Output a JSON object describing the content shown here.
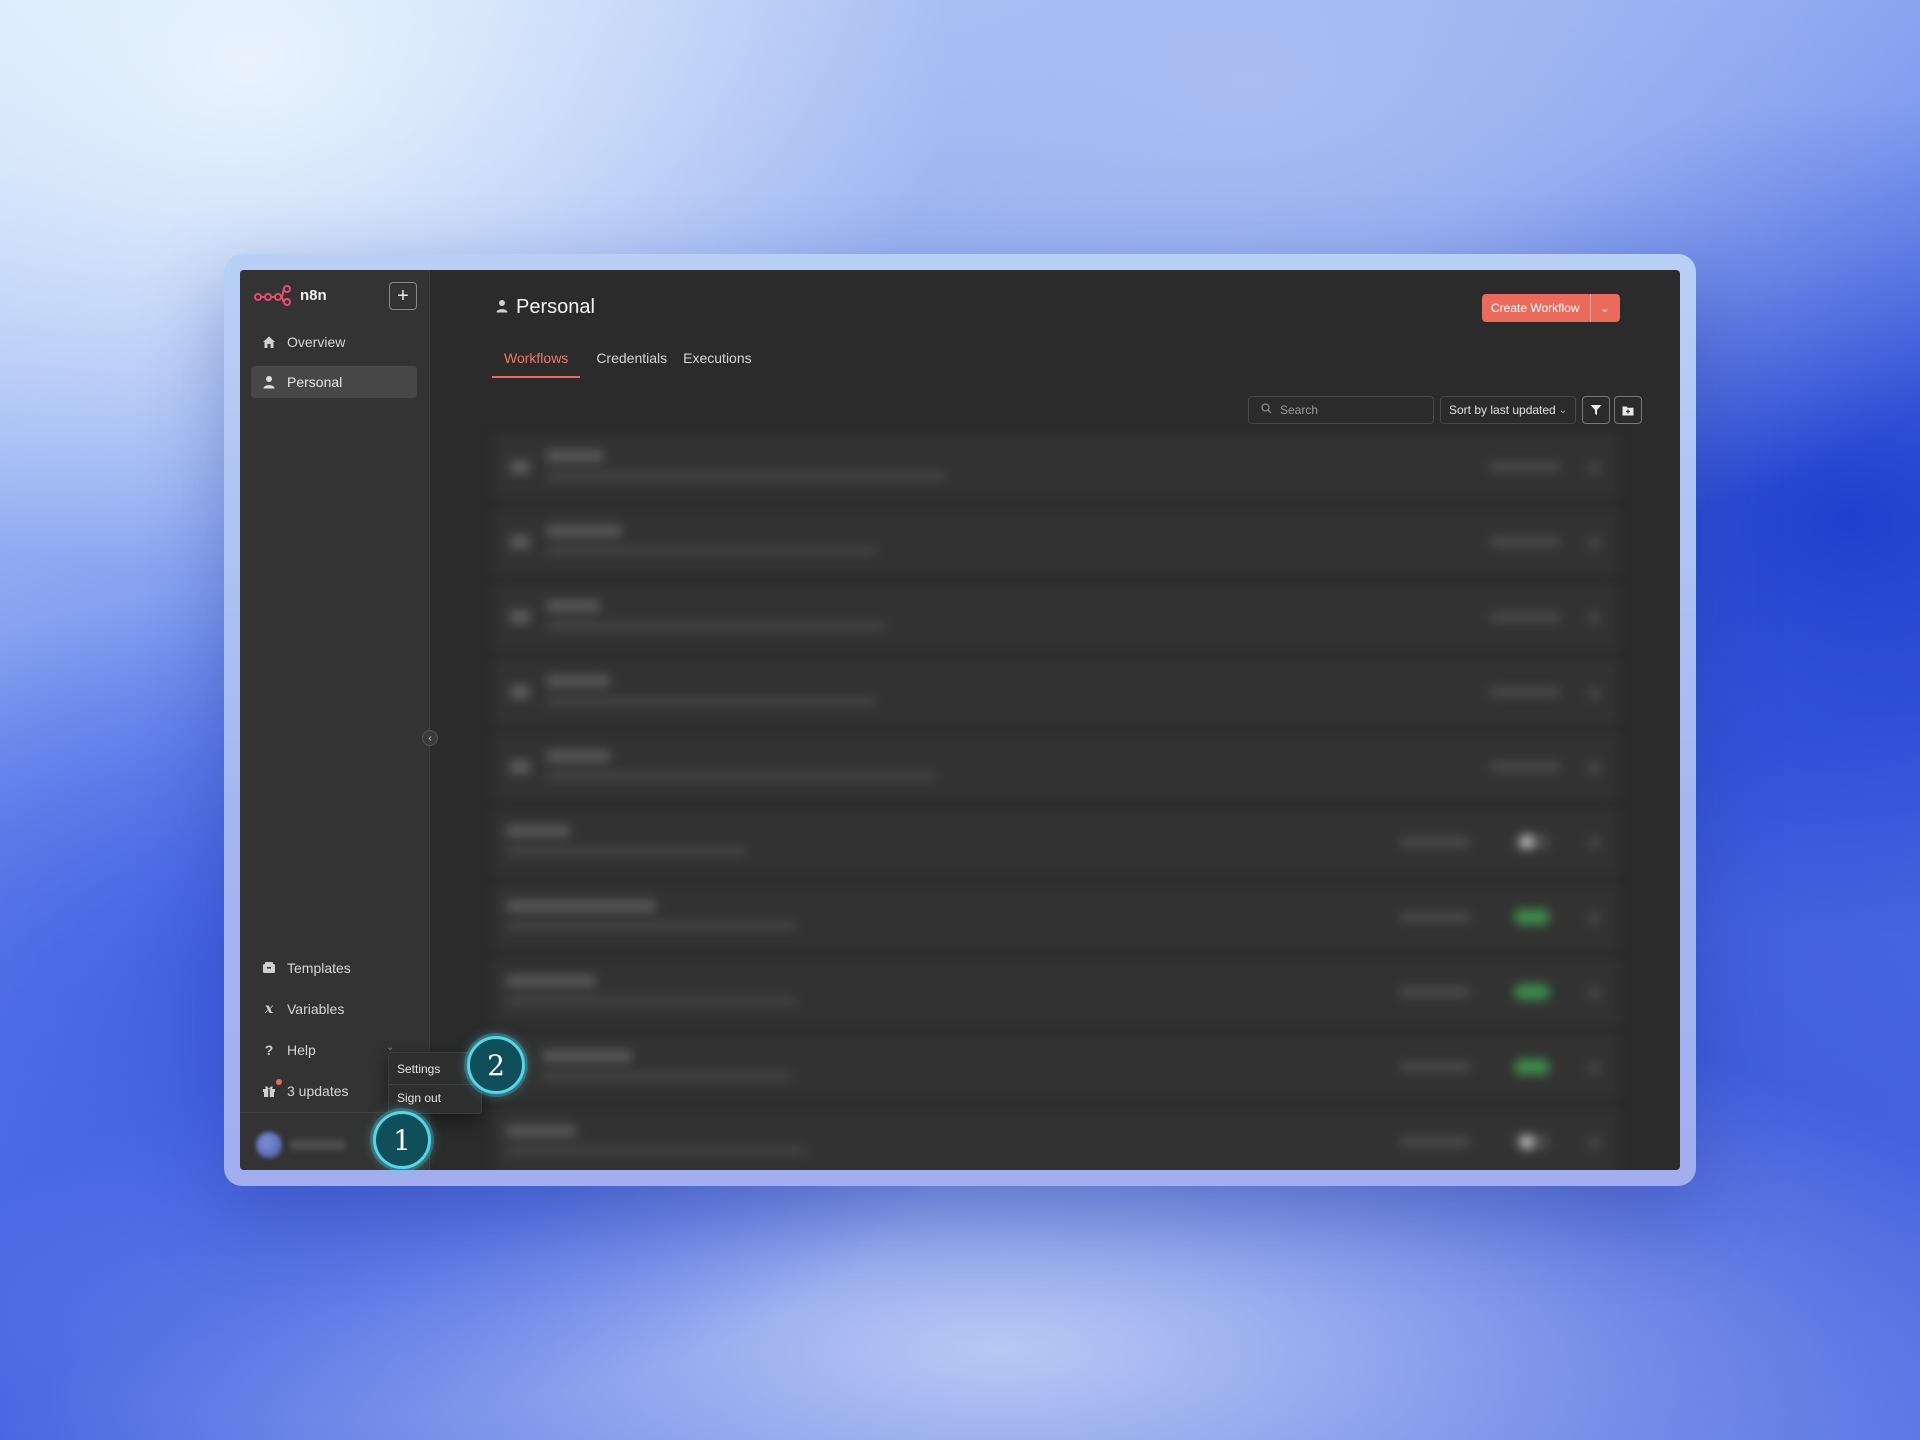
{
  "app": {
    "brand": "n8n",
    "add_label": "+"
  },
  "sidebar": {
    "top_items": [
      {
        "label": "Overview",
        "icon": "house-icon"
      },
      {
        "label": "Personal",
        "icon": "user-icon",
        "active": true
      }
    ],
    "bottom_items": [
      {
        "label": "Templates",
        "icon": "box-icon"
      },
      {
        "label": "Variables",
        "icon": "variable-icon"
      },
      {
        "label": "Help",
        "icon": "question-icon"
      },
      {
        "label": "3 updates",
        "icon": "gift-icon"
      }
    ]
  },
  "user_menu": {
    "items": [
      "Settings",
      "Sign out"
    ]
  },
  "header": {
    "title": "Personal",
    "create_label": "Create Workflow"
  },
  "tabs": [
    "Workflows",
    "Credentials",
    "Executions"
  ],
  "toolbar": {
    "search_placeholder": "Search",
    "sort_label": "Sort by last updated"
  },
  "callouts": [
    "1",
    "2"
  ],
  "colors": {
    "accent": "#ea6b5b",
    "callout_ring": "#52d6ea",
    "sidebar_bg": "#333333",
    "main_bg": "#2b2b2b"
  }
}
